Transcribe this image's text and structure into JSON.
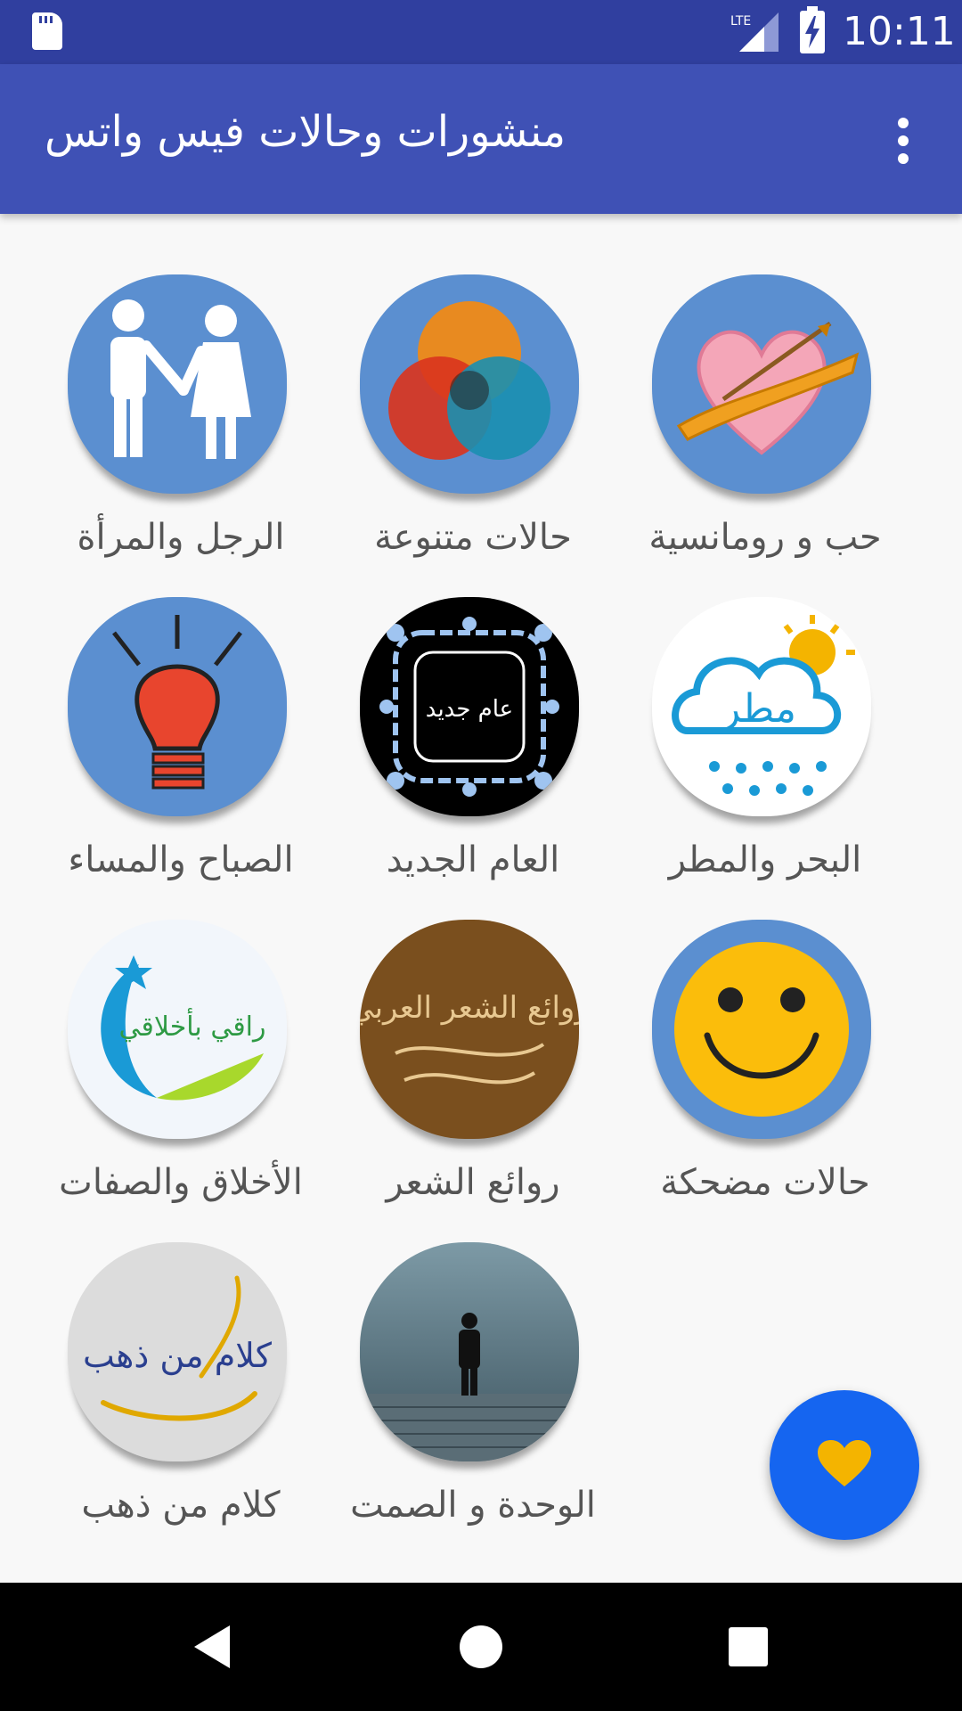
{
  "status_bar": {
    "time": "10:11",
    "network": "LTE"
  },
  "app_bar": {
    "title": "منشورات وحالات فيس واتس"
  },
  "categories": [
    {
      "label": "حب و رومانسية",
      "icon": "heart-arrow-icon"
    },
    {
      "label": "حالات متنوعة",
      "icon": "color-circles-icon"
    },
    {
      "label": "الرجل والمرأة",
      "icon": "man-woman-icon"
    },
    {
      "label": "البحر والمطر",
      "icon": "cloud-rain-icon",
      "icon_text": "مطر"
    },
    {
      "label": "العام الجديد",
      "icon": "ornament-frame-icon",
      "icon_text": "عام جديد"
    },
    {
      "label": "الصباح والمساء",
      "icon": "light-bulb-icon"
    },
    {
      "label": "حالات مضحكة",
      "icon": "smiley-icon"
    },
    {
      "label": "روائع الشعر",
      "icon": "calligraphy-icon",
      "icon_text": "روائع الشعر العربي"
    },
    {
      "label": "الأخلاق والصفات",
      "icon": "moon-star-icon",
      "icon_text": "راقي بأخلاقي"
    },
    {
      "label": "كلام من ذهب",
      "icon": "gold-calligraphy-icon",
      "icon_text": "كلام من ذهب"
    },
    {
      "label": "الوحدة و الصمت",
      "icon": "lonely-man-icon"
    }
  ],
  "colors": {
    "status_bar": "#303f9f",
    "app_bar": "#3f51b5",
    "icon_blue": "#5b8fd0",
    "fab": "#1565f0",
    "fab_heart": "#f4b400"
  }
}
